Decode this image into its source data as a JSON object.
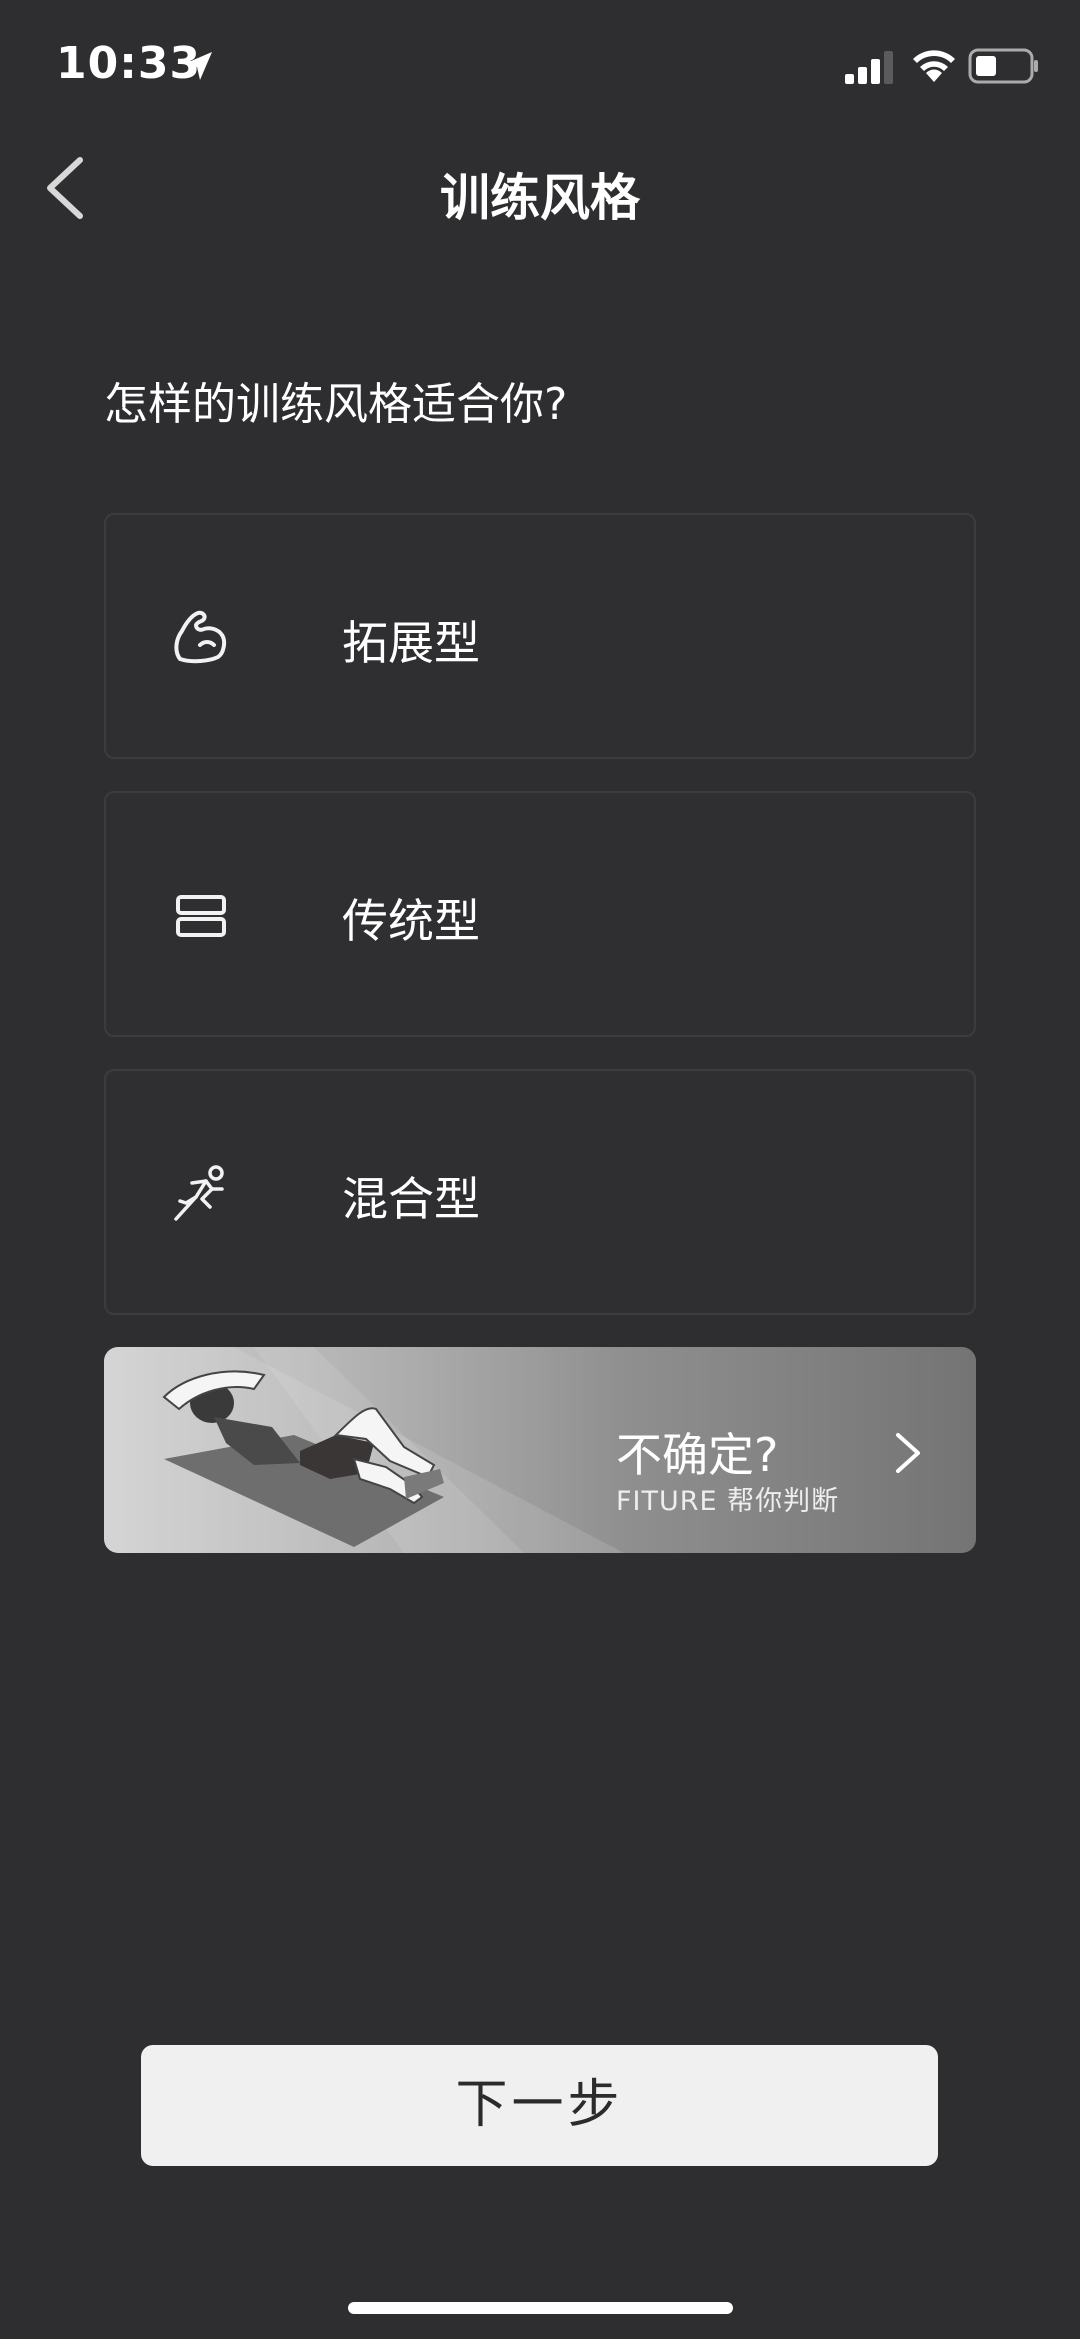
{
  "status_bar": {
    "time": "10:33"
  },
  "nav": {
    "title": "训练风格"
  },
  "question": "怎样的训练风格适合你?",
  "options": [
    {
      "label": "拓展型",
      "icon": "flexed-arm-icon"
    },
    {
      "label": "传统型",
      "icon": "dumbbell-plate-icon"
    },
    {
      "label": "混合型",
      "icon": "running-figure-icon"
    }
  ],
  "banner": {
    "title": "不确定?",
    "subtitle": "FITURE 帮你判断"
  },
  "next_button": {
    "label": "下一步"
  },
  "colors": {
    "background": "#2e2e30",
    "card_border": "#3c3c3f",
    "button_bg": "#f0f0f0"
  }
}
